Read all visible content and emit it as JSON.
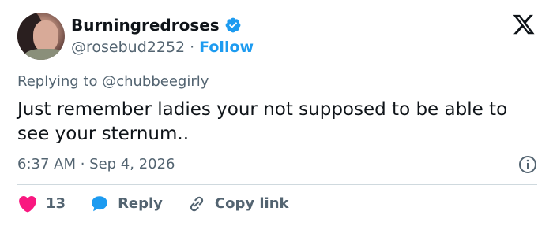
{
  "author": {
    "display_name": "Burningredroses",
    "handle": "@rosebud2252",
    "separator": "·",
    "follow_label": "Follow"
  },
  "reply_context": {
    "text": "Replying to @chubbeegirly"
  },
  "tweet": {
    "text": "Just remember ladies your not supposed to be able to see your sternum..",
    "timestamp": "6:37 AM · Sep 4, 2026"
  },
  "actions": {
    "like_count": "13",
    "reply_label": "Reply",
    "copy_link_label": "Copy link"
  },
  "colors": {
    "brand_blue": "#1d9bf0",
    "like_pink": "#f91880",
    "secondary_text": "#536471"
  },
  "icons": [
    "verified-badge-icon",
    "x-logo-icon",
    "info-icon",
    "heart-icon",
    "reply-bubble-icon",
    "link-icon"
  ]
}
